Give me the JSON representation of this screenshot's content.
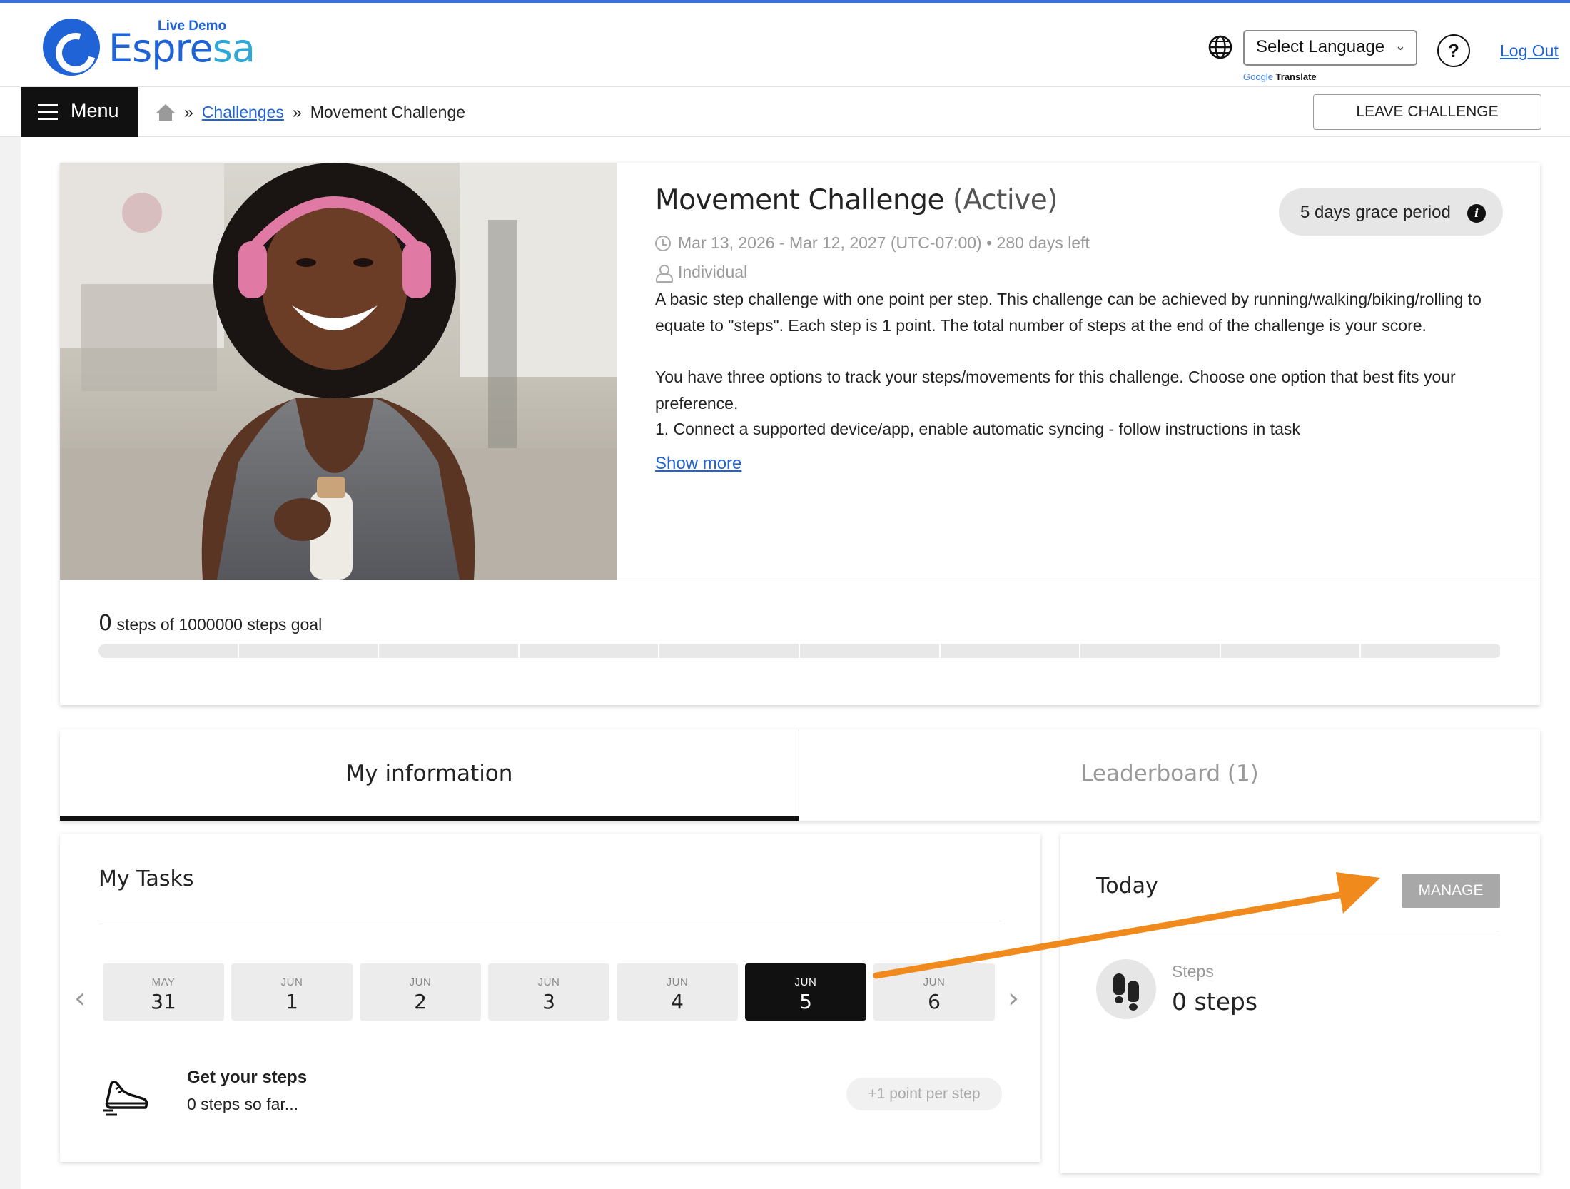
{
  "header": {
    "logo_live_demo": "Live Demo",
    "logo_text_a": "Espre",
    "logo_text_b": "sa",
    "language_select": "Select Language",
    "google_label": "Google",
    "translate_label": "Translate",
    "help_label": "?",
    "logout_label": "Log Out",
    "brand_color": "#1f63d6"
  },
  "nav": {
    "menu_label": "Menu",
    "breadcrumb_sep": "»",
    "breadcrumb_link": "Challenges",
    "breadcrumb_current": "Movement Challenge",
    "leave_button": "LEAVE CHALLENGE"
  },
  "challenge": {
    "title": "Movement Challenge",
    "status": "(Active)",
    "grace_period": "5 days grace period",
    "grace_info_icon": "i",
    "date_range": "Mar 13, 2026 - Mar 12, 2027 (UTC-07:00) • 280 days left",
    "type": "Individual",
    "description_1": "A basic step challenge with one point per step.  This challenge can be achieved by running/walking/biking/rolling to equate to \"steps\". Each step is 1 point. The total number of steps at the end of the challenge is your score.",
    "description_2": "You have three options to track your steps/movements for this challenge. Choose one option that best fits your preference.",
    "description_3": "1. Connect a supported device/app, enable automatic syncing - follow instructions in task",
    "show_more": "Show more",
    "progress_value": "0",
    "progress_text": "steps of 1000000 steps goal",
    "progress_fraction": 0
  },
  "tabs": {
    "my_information": "My information",
    "leaderboard": "Leaderboard (1)"
  },
  "tasks": {
    "title": "My Tasks",
    "prev_arrow": "‹",
    "next_arrow": "›",
    "days": [
      {
        "month": "MAY",
        "day": "31"
      },
      {
        "month": "JUN",
        "day": "1"
      },
      {
        "month": "JUN",
        "day": "2"
      },
      {
        "month": "JUN",
        "day": "3"
      },
      {
        "month": "JUN",
        "day": "4"
      },
      {
        "month": "JUN",
        "day": "5"
      },
      {
        "month": "JUN",
        "day": "6"
      }
    ],
    "selected_day_index": 5,
    "task_title": "Get your steps",
    "task_subtitle": "0 steps so far...",
    "task_points": "+1 point per step"
  },
  "today": {
    "title": "Today",
    "manage_button": "MANAGE",
    "steps_label": "Steps",
    "steps_value": "0 steps"
  },
  "annotation_color": "#f08a1c"
}
